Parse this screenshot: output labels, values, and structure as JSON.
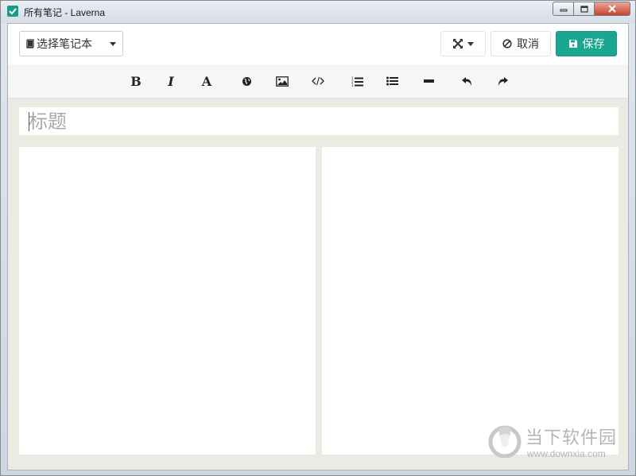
{
  "window": {
    "title": "所有笔记 - Laverna",
    "controls": {
      "minimize": "▭",
      "maximize": "▢",
      "close": "✕"
    }
  },
  "topbar": {
    "notebook_select": {
      "label": "选择笔记本",
      "icon": "book-icon"
    },
    "fullscreen_button": {
      "icon": "expand-icon"
    },
    "cancel_button": {
      "label": "取消",
      "icon": "ban-icon"
    },
    "save_button": {
      "label": "保存",
      "icon": "floppy-icon"
    }
  },
  "toolbar": {
    "bold": "B",
    "italic": "I",
    "heading": "A",
    "items": [
      {
        "name": "bold",
        "icon": "bold-icon"
      },
      {
        "name": "italic",
        "icon": "italic-icon"
      },
      {
        "name": "heading",
        "icon": "heading-icon"
      },
      {
        "name": "link",
        "icon": "globe-icon"
      },
      {
        "name": "image",
        "icon": "image-icon"
      },
      {
        "name": "code",
        "icon": "code-icon"
      },
      {
        "name": "ordered-list",
        "icon": "ordered-list-icon"
      },
      {
        "name": "unordered-list",
        "icon": "list-icon"
      },
      {
        "name": "hr",
        "icon": "minus-icon"
      },
      {
        "name": "undo",
        "icon": "undo-icon"
      },
      {
        "name": "redo",
        "icon": "redo-icon"
      }
    ]
  },
  "editor": {
    "title_placeholder": "标题"
  },
  "watermark": {
    "text": "当下软件园",
    "url": "www.downxia.com"
  },
  "colors": {
    "accent": "#1aa68f",
    "background": "#ebebe3"
  }
}
